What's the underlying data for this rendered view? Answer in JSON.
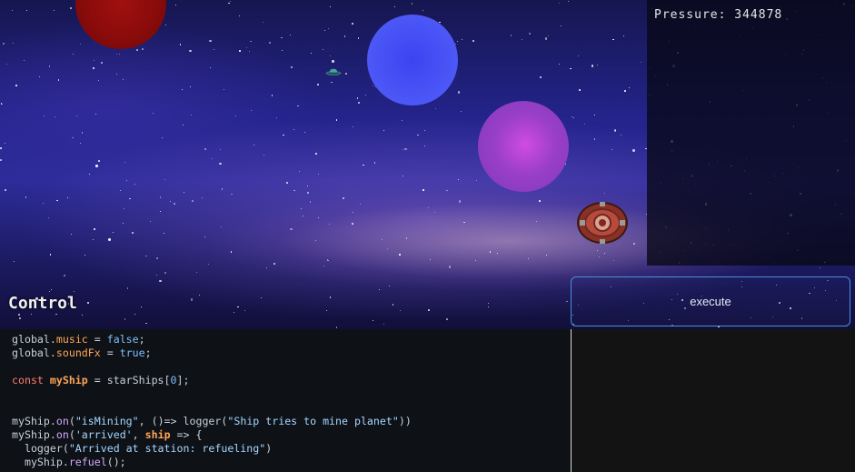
{
  "hud": {
    "pressure_label": "Pressure:",
    "pressure_value": "344878"
  },
  "scene": {
    "planets": [
      {
        "name": "red-planet",
        "color": "#8a0b0b"
      },
      {
        "name": "blue-planet",
        "color": "#4a55f6"
      },
      {
        "name": "purple-planet",
        "color": "#a040c8"
      }
    ],
    "icons": [
      "ufo-ship-icon",
      "space-station-icon"
    ]
  },
  "control": {
    "title": "Control",
    "execute_label": "execute"
  },
  "code": {
    "l1_a": "global",
    "l1_b": ".",
    "l1_c": "music",
    "l1_d": " = ",
    "l1_e": "false",
    "l1_f": ";",
    "l2_a": "global",
    "l2_b": ".",
    "l2_c": "soundFx",
    "l2_d": " = ",
    "l2_e": "true",
    "l2_f": ";",
    "l4_a": "const ",
    "l4_b": "myShip",
    "l4_c": " = starShips[",
    "l4_d": "0",
    "l4_e": "];",
    "l7_a": "myShip.",
    "l7_b": "on",
    "l7_c": "(",
    "l7_d": "\"isMining\"",
    "l7_e": ", ()=> logger(",
    "l7_f": "\"Ship tries to mine planet\"",
    "l7_g": "))",
    "l8_a": "myShip.",
    "l8_b": "on",
    "l8_c": "(",
    "l8_d": "'arrived'",
    "l8_e": ", ",
    "l8_f": "ship",
    "l8_g": " => {",
    "l9_a": "  logger(",
    "l9_b": "\"Arrived at station: refueling\"",
    "l9_c": ")",
    "l10_a": "  myShip.",
    "l10_b": "refuel",
    "l10_c": "();"
  },
  "colors": {
    "execute_border": "#4a90d9",
    "editor_bg": "#0e1116"
  }
}
